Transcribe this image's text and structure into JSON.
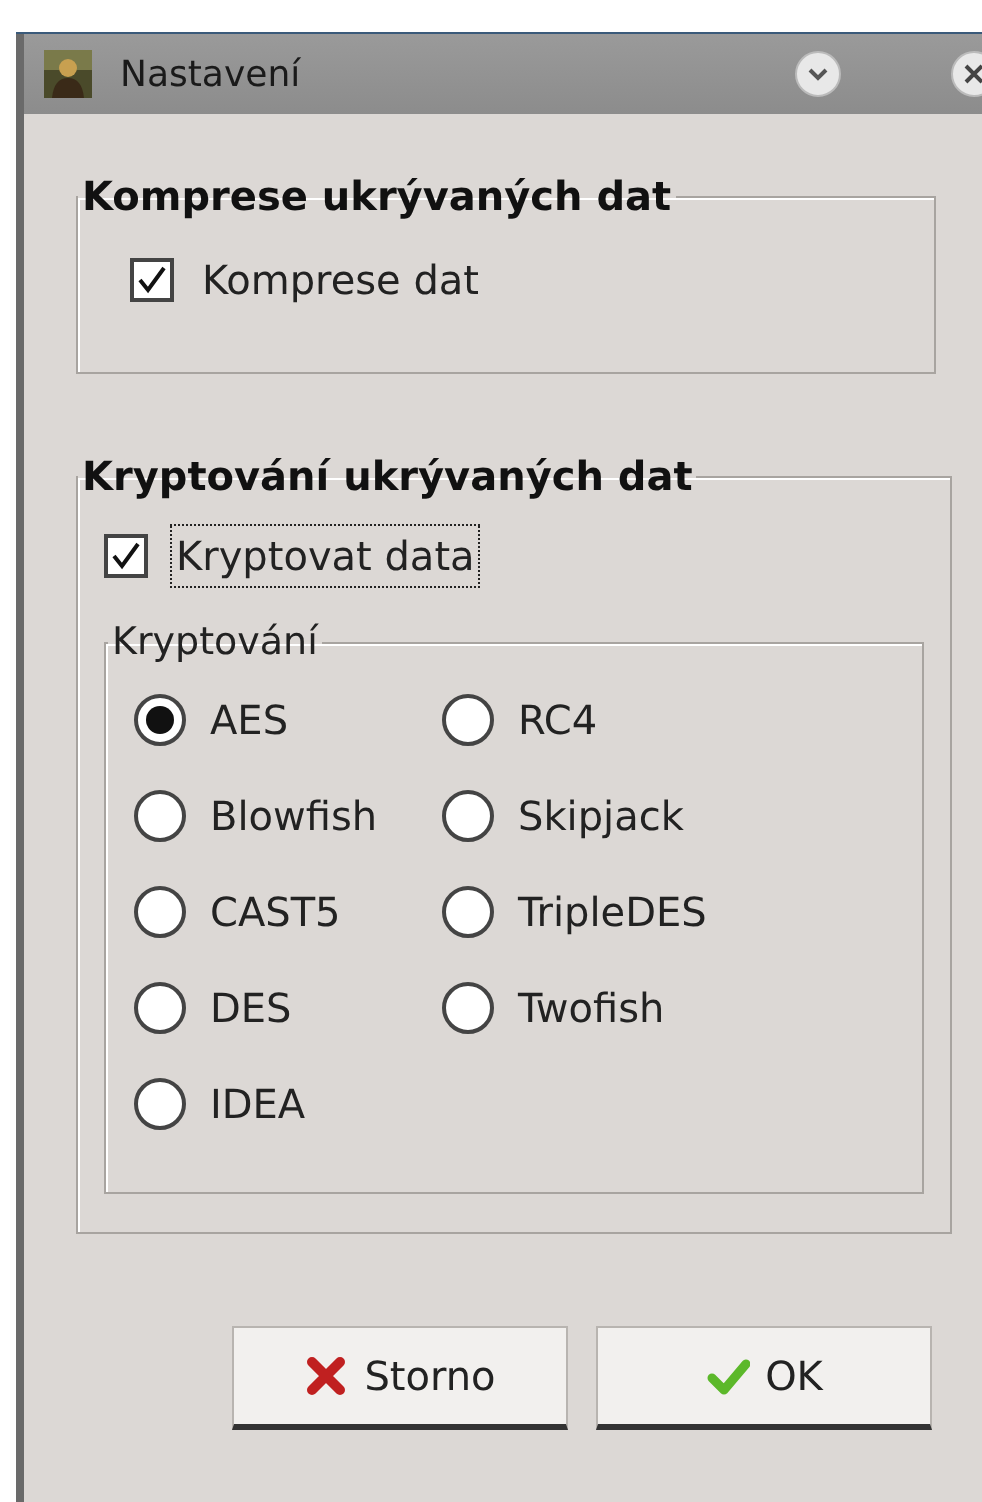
{
  "window": {
    "title": "Nastavení"
  },
  "compression": {
    "title": "Komprese ukrývaných dat",
    "checkbox": {
      "label": "Komprese dat",
      "checked": true
    }
  },
  "encryption": {
    "title": "Kryptování ukrývaných dat",
    "checkbox": {
      "label": "Kryptovat data",
      "checked": true,
      "focused": true
    },
    "algorithms": {
      "title": "Kryptování",
      "options": [
        {
          "label": "AES",
          "selected": true
        },
        {
          "label": "RC4",
          "selected": false
        },
        {
          "label": "Blowfish",
          "selected": false
        },
        {
          "label": "Skipjack",
          "selected": false
        },
        {
          "label": "CAST5",
          "selected": false
        },
        {
          "label": "TripleDES",
          "selected": false
        },
        {
          "label": "DES",
          "selected": false
        },
        {
          "label": "Twofish",
          "selected": false
        },
        {
          "label": "IDEA",
          "selected": false
        }
      ]
    }
  },
  "buttons": [
    {
      "label": "Storno",
      "kind": "cancel"
    },
    {
      "label": "OK",
      "kind": "ok"
    }
  ]
}
